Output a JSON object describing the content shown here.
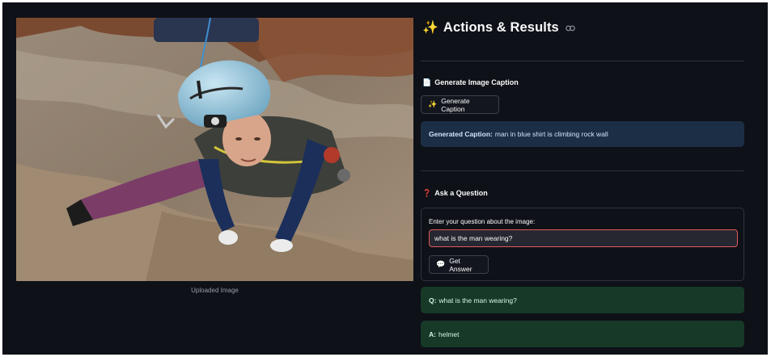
{
  "image_panel": {
    "caption": "Uploaded Image"
  },
  "header": {
    "title_icon": "✨",
    "title": "Actions & Results"
  },
  "caption_section": {
    "icon": "📄",
    "heading": "Generate Image Caption",
    "button_icon": "✨",
    "button_label": "Generate Caption",
    "result_label": "Generated Caption:",
    "result_text": "man in blue shirt is climbing rock wall"
  },
  "question_section": {
    "icon": "❓",
    "heading": "Ask a Question",
    "input_label": "Enter your question about the image:",
    "input_value": "what is the man wearing?",
    "button_icon": "💬",
    "button_label": "Get Answer"
  },
  "qa": {
    "q_label": "Q:",
    "question": "what is the man wearing?",
    "a_label": "A:",
    "answer": "helmet"
  },
  "colors": {
    "background": "#0e1117",
    "caption_alert": "#1b2e45",
    "answer_alert": "#173928",
    "input_focus_border": "#e35a5a"
  }
}
